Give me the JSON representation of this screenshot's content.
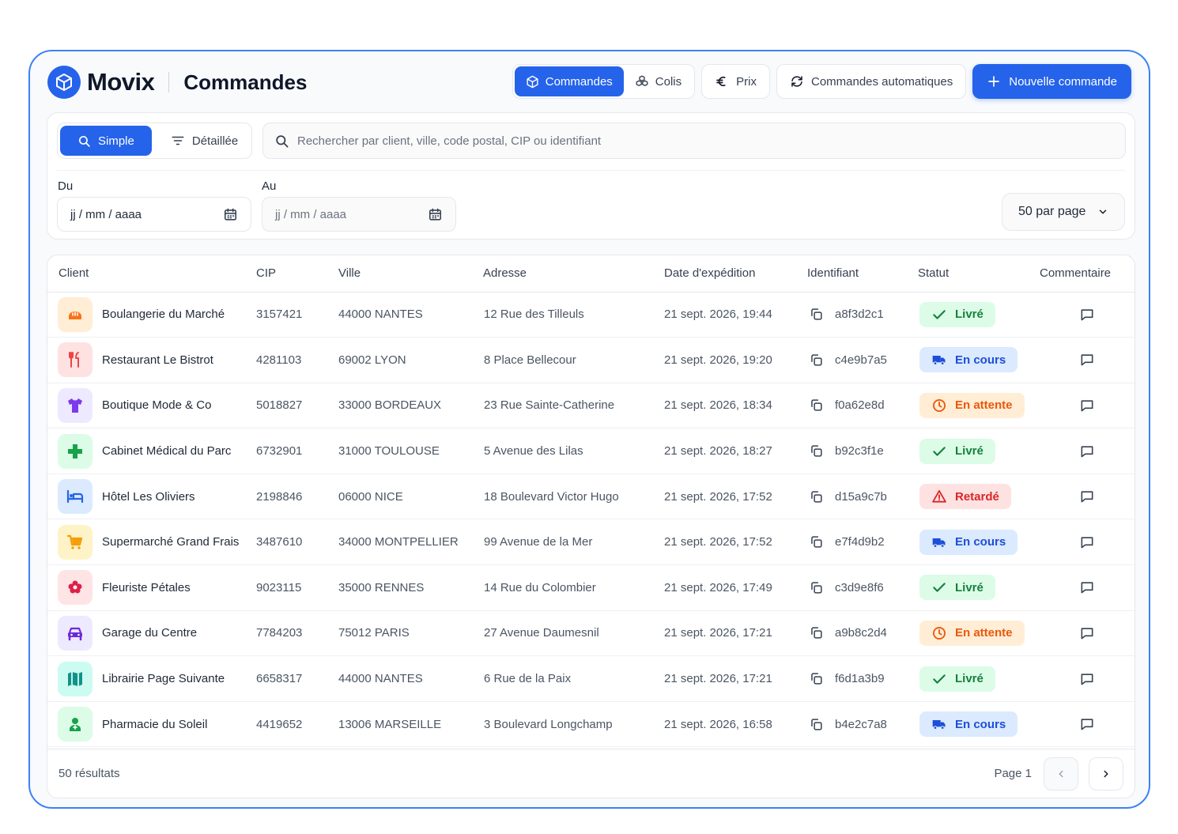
{
  "app": {
    "brand": "Movix",
    "page_title": "Commandes",
    "nav": {
      "commandes": "Commandes",
      "colis": "Colis",
      "prix": "Prix",
      "auto": "Commandes automatiques",
      "new_order": "Nouvelle commande"
    }
  },
  "filters": {
    "mode_simple": "Simple",
    "mode_detailed": "Détaillée",
    "search_placeholder": "Rechercher par client, ville, code postal, CIP ou identifiant",
    "from_label": "Du",
    "to_label": "Au",
    "from_placeholder": "jj / mm / aaaa",
    "to_placeholder": "jj / mm / aaaa",
    "per_page": "50 par page"
  },
  "table": {
    "headers": {
      "client": "Client",
      "cip": "CIP",
      "ville": "Ville",
      "adresse": "Adresse",
      "date": "Date d'expédition",
      "id": "Identifiant",
      "statut": "Statut",
      "commentaire": "Commentaire"
    },
    "rows": [
      {
        "client": "Boulangerie du Marché",
        "icon": "bread-icon",
        "icon_color": "#f97316",
        "icon_bg": "#ffedd5",
        "cip": "3157421",
        "ville": "44000 NANTES",
        "adresse": "12 Rue des Tilleuls",
        "date": "21 sept. 2026, 19:44",
        "id": "a8f3d2c1",
        "status": "Livré",
        "status_type": "livre"
      },
      {
        "client": "Restaurant Le Bistrot",
        "icon": "utensils-icon",
        "icon_color": "#ef4444",
        "icon_bg": "#fee2e2",
        "cip": "4281103",
        "ville": "69002 LYON",
        "adresse": "8 Place Bellecour",
        "date": "21 sept. 2026, 19:20",
        "id": "c4e9b7a5",
        "status": "En cours",
        "status_type": "encours"
      },
      {
        "client": "Boutique Mode & Co",
        "icon": "shirt-icon",
        "icon_color": "#7c3aed",
        "icon_bg": "#ede9fe",
        "cip": "5018827",
        "ville": "33000 BORDEAUX",
        "adresse": "23 Rue Sainte-Catherine",
        "date": "21 sept. 2026, 18:34",
        "id": "f0a62e8d",
        "status": "En attente",
        "status_type": "attente"
      },
      {
        "client": "Cabinet Médical du Parc",
        "icon": "medical-cross-icon",
        "icon_color": "#16a34a",
        "icon_bg": "#dcfce7",
        "cip": "6732901",
        "ville": "31000 TOULOUSE",
        "adresse": "5 Avenue des Lilas",
        "date": "21 sept. 2026, 18:27",
        "id": "b92c3f1e",
        "status": "Livré",
        "status_type": "livre"
      },
      {
        "client": "Hôtel Les Oliviers",
        "icon": "bed-icon",
        "icon_color": "#2563eb",
        "icon_bg": "#dbeafe",
        "cip": "2198846",
        "ville": "06000 NICE",
        "adresse": "18 Boulevard Victor Hugo",
        "date": "21 sept. 2026, 17:52",
        "id": "d15a9c7b",
        "status": "Retardé",
        "status_type": "retard"
      },
      {
        "client": "Supermarché Grand Frais",
        "icon": "cart-icon",
        "icon_color": "#f59e0b",
        "icon_bg": "#fef3c7",
        "cip": "3487610",
        "ville": "34000 MONTPELLIER",
        "adresse": "99 Avenue de la Mer",
        "date": "21 sept. 2026, 17:52",
        "id": "e7f4d9b2",
        "status": "En cours",
        "status_type": "encours"
      },
      {
        "client": "Fleuriste Pétales",
        "icon": "flower-icon",
        "icon_color": "#e11d48",
        "icon_bg": "#ffe4e6",
        "cip": "9023115",
        "ville": "35000 RENNES",
        "adresse": "14 Rue du Colombier",
        "date": "21 sept. 2026, 17:49",
        "id": "c3d9e8f6",
        "status": "Livré",
        "status_type": "livre"
      },
      {
        "client": "Garage du Centre",
        "icon": "car-icon",
        "icon_color": "#6d28d9",
        "icon_bg": "#ede9fe",
        "cip": "7784203",
        "ville": "75012 PARIS",
        "adresse": "27 Avenue Daumesnil",
        "date": "21 sept. 2026, 17:21",
        "id": "a9b8c2d4",
        "status": "En attente",
        "status_type": "attente"
      },
      {
        "client": "Librairie Page Suivante",
        "icon": "book-map-icon",
        "icon_color": "#0d9488",
        "icon_bg": "#ccfbf1",
        "cip": "6658317",
        "ville": "44000 NANTES",
        "adresse": "6 Rue de la Paix",
        "date": "21 sept. 2026, 17:21",
        "id": "f6d1a3b9",
        "status": "Livré",
        "status_type": "livre"
      },
      {
        "client": "Pharmacie du Soleil",
        "icon": "pharmacy-icon",
        "icon_color": "#16a34a",
        "icon_bg": "#dcfce7",
        "cip": "4419652",
        "ville": "13006 MARSEILLE",
        "adresse": "3 Boulevard Longchamp",
        "date": "21 sept. 2026, 16:58",
        "id": "b4e2c7a8",
        "status": "En cours",
        "status_type": "encours"
      }
    ]
  },
  "footer": {
    "results": "50 résultats",
    "page": "Page 1"
  },
  "colors": {
    "accent": "#2563eb",
    "livre": "#15803d",
    "encours": "#1d4ed8",
    "attente": "#ea580c",
    "retard": "#dc2626"
  }
}
